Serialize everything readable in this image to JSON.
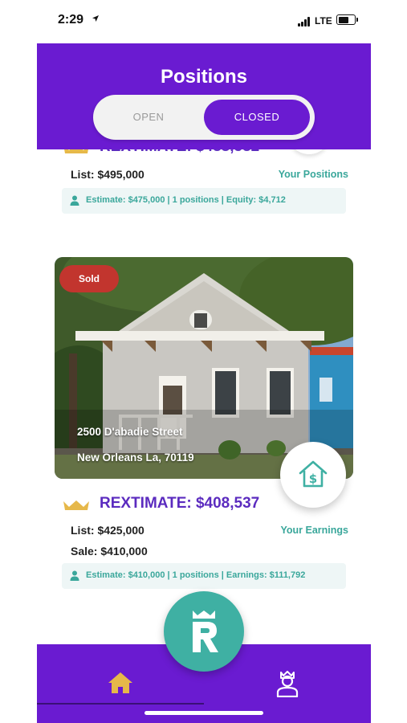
{
  "status_bar": {
    "time": "2:29",
    "network": "LTE"
  },
  "header": {
    "title": "Positions",
    "toggle": {
      "open_label": "OPEN",
      "closed_label": "CLOSED",
      "selected": "CLOSED"
    }
  },
  "previous_card": {
    "rextimate": "REXTIMATE: $488,582",
    "list_price": "List: $495,000",
    "link_label": "Your Positions",
    "summary": "Estimate: $475,000 | 1 positions | Equity: $4,712"
  },
  "card": {
    "badge": "Sold",
    "street": "2500 D'abadie Street",
    "city": "New Orleans La, 70119",
    "rextimate": "REXTIMATE: $408,537",
    "list_price": "List: $425,000",
    "sale_price": "Sale: $410,000",
    "link_label": "Your Earnings",
    "summary": "Estimate: $410,000 | 1 positions | Earnings: $111,792"
  },
  "icons": {
    "status_arrow": "location-arrow-icon",
    "house_dollar": "house-dollar-icon",
    "crown": "crown-icon",
    "person": "person-icon",
    "home": "home-icon",
    "profile": "profile-icon",
    "logo": "rextimate-logo-icon"
  },
  "colors": {
    "brand_purple": "#6a1bd1",
    "accent_teal": "#3fb0a3",
    "crown_gold": "#e6b84a",
    "sold_red": "#c2352e"
  }
}
